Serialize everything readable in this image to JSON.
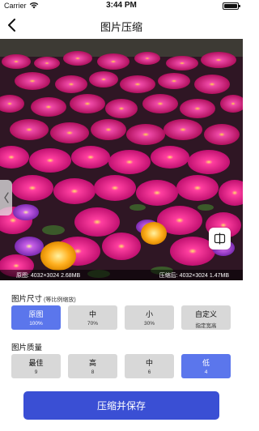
{
  "status_bar": {
    "carrier": "Carrier",
    "time": "3:44 PM",
    "wifi_icon": "wifi-icon",
    "battery_icon": "battery-icon"
  },
  "nav": {
    "title": "图片压缩",
    "back_icon": "chevron-left-icon"
  },
  "preview": {
    "original_label": "原图: 4032×3024  2.68MB",
    "compressed_label": "压缩后: 4032×3024  1.47MB",
    "compare_icon": "split-compare-icon",
    "handle_icon": "chevron-left-icon"
  },
  "size_section": {
    "title": "图片尺寸",
    "hint": "(等比例缩放)",
    "options": [
      {
        "label": "原图",
        "sub": "100%",
        "selected": true
      },
      {
        "label": "中",
        "sub": "70%",
        "selected": false
      },
      {
        "label": "小",
        "sub": "30%",
        "selected": false
      },
      {
        "label": "自定义",
        "sub": "指定宽高",
        "selected": false
      }
    ]
  },
  "quality_section": {
    "title": "图片质量",
    "options": [
      {
        "label": "最佳",
        "sub": "9",
        "selected": false
      },
      {
        "label": "高",
        "sub": "8",
        "selected": false
      },
      {
        "label": "中",
        "sub": "6",
        "selected": false
      },
      {
        "label": "低",
        "sub": "4",
        "selected": true
      }
    ]
  },
  "actions": {
    "compress_save": "压缩并保存"
  },
  "colors": {
    "accent": "#5b76ec",
    "primary_button": "#3a4fd4",
    "unselected_option": "#d8d8d8"
  }
}
